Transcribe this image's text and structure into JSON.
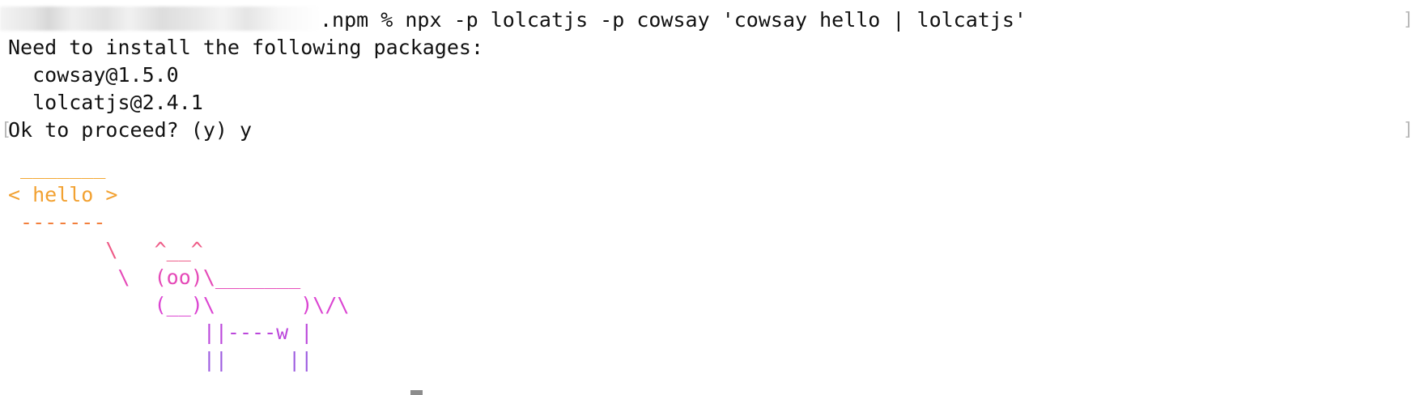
{
  "terminal": {
    "command": ".npm % npx -p lolcatjs -p cowsay 'cowsay hello | lolcatjs'",
    "lines": [
      "Need to install the following packages:",
      "  cowsay@1.5.0",
      "  lolcatjs@2.4.1",
      "Ok to proceed? (y) y"
    ],
    "right_bracket": "]",
    "left_bracket": "[",
    "cow": [
      {
        "text": " _______",
        "color": "#f3a62f"
      },
      {
        "text": "< hello >",
        "color": "#f2a131"
      },
      {
        "text": " -------",
        "color": "#f27f3c"
      },
      {
        "text": "        \\   ^__^",
        "color": "#ee5b87"
      },
      {
        "text": "         \\  (oo)\\_______",
        "color": "#e54ab8"
      },
      {
        "text": "            (__)\\       )\\/\\",
        "color": "#db45d2"
      },
      {
        "text": "                ||----w |",
        "color": "#bb47db"
      },
      {
        "text": "                ||     ||",
        "color": "#9d5ce0"
      }
    ]
  }
}
